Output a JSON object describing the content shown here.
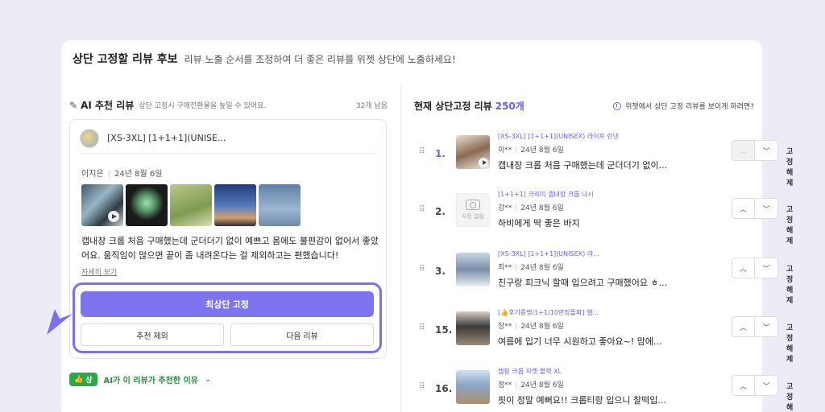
{
  "header": {
    "title": "상단 고정할 리뷰 후보",
    "subtitle": "리뷰 노출 순서를 조정하여 더 좋은 리뷰를 위젯 상단에 노출하세요!"
  },
  "ai_section": {
    "title": "AI 추천 리뷰",
    "description": "상단 고정시 구매전환율을 높일 수 있어요.",
    "count": "32개 남음",
    "card": {
      "product_name": "[XS-3XL] [1+1+1](UNISE...",
      "author": "이지은",
      "date": "24년 8월 6일",
      "review_text": "캡내장 크롭 처음 구매했는데 군더더기 없이 예쁘고 몸에도 불편감이 없어서 좋았어요. 움직임이 많으면 끝이 좀 내려온다는 걸 제외하고는 편했습니다!",
      "more_link": "자세히 보기"
    },
    "buttons": {
      "pin_top": "최상단 고정",
      "exclude": "추천 제외",
      "next": "다음 리뷰"
    },
    "reason": {
      "badge": "상",
      "text": "AI가 이 리뷰가 추천한 이유"
    }
  },
  "pinned_section": {
    "title": "현재 상단고정 리뷰",
    "count": "250개",
    "info_link": "위젯에서 상단 고정 리뷰를 보이게 하려면?",
    "unpin_label": "고정해제",
    "items": [
      {
        "rank": "1.",
        "product": "[XS-3XL] [1+1+1](UNISEX) 라이프 린넨",
        "author": "이**",
        "date": "24년 8월 6일",
        "text": "캡내장 크롭 처음 구매했는데 군더더기 없이...",
        "thumb": "video"
      },
      {
        "rank": "2.",
        "product": "[1+1+1] 크리미 캡내장 크롭 나시",
        "author": "강**",
        "date": "24년 8월 6일",
        "text": "하비에게 딱 좋은 바지",
        "thumb": "none",
        "no_photo": "사진 없음"
      },
      {
        "rank": "3.",
        "product": "[XS-3XL] [1+1+1](UNISEX) 라...",
        "author": "최**",
        "date": "24년 8월 6일",
        "text": "친구랑 피크닉 할때 입으려고 구매했어요 ㅎ...",
        "thumb": "photo"
      },
      {
        "rank": "15.",
        "product": "[👍후기증명/1+1/10만장돌파] 엘...",
        "author": "장**",
        "date": "24년 8월 6일",
        "text": "여름에 입기 너무 시원하고 좋아요~! 맘에...",
        "thumb": "photo"
      },
      {
        "rank": "16.",
        "product": "캠핑 크롭 자켓 블랙 XL",
        "author": "정**",
        "date": "24년 8월 6일",
        "text": "핏이 정말 예뻐요!! 크롭티랑 입으니 찰떡입...",
        "thumb": "photo"
      }
    ]
  }
}
